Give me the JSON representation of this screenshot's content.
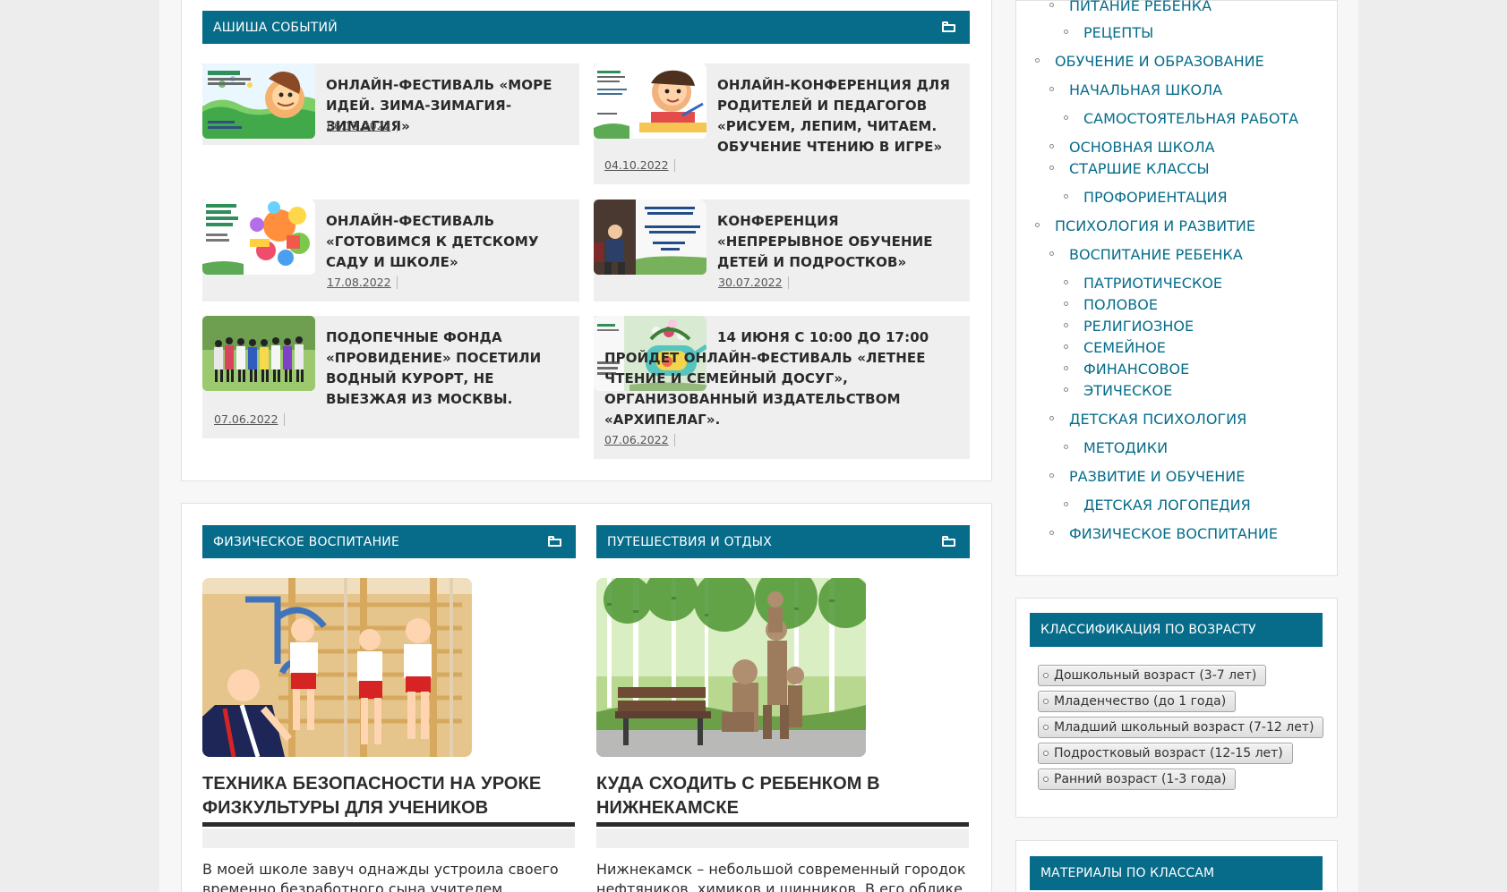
{
  "sections": {
    "events": {
      "title": "АШИША СОБЫТИЙ",
      "items": [
        {
          "title": "ОНЛАЙН-ФЕСТИВАЛЬ «МОРЕ ИДЕЙ. ЗИМА-ЗИМАГИЯ-ЗИМАГИЯ»",
          "date": "06.12.2022"
        },
        {
          "title": "ОНЛАЙН-КОНФЕРЕНЦИЯ ДЛЯ РОДИТЕЛЕЙ И ПЕДАГОГОВ «РИСУЕМ, ЛЕПИМ, ЧИТАЕМ. ОБУЧЕНИЕ ЧТЕНИЮ В ИГРЕ»",
          "date": "04.10.2022"
        },
        {
          "title": "ОНЛАЙН-ФЕСТИВАЛЬ «ГОТОВИМСЯ К ДЕТСКОМУ САДУ И ШКОЛЕ»",
          "date": "17.08.2022"
        },
        {
          "title": "КОНФЕРЕНЦИЯ «НЕПРЕРЫВНОЕ ОБУЧЕНИЕ ДЕТЕЙ И ПОДРОСТКОВ»",
          "date": "30.07.2022"
        },
        {
          "title": "ПОДОПЕЧНЫЕ ФОНДА «ПРОВИДЕНИЕ» ПОСЕТИЛИ ВОДНЫЙ КУРОРТ, НЕ ВЫЕЗЖАЯ ИЗ МОСКВЫ.",
          "date": "07.06.2022"
        },
        {
          "title": "14 ИЮНЯ С 10:00 ДО 17:00 ПРОЙДЕТ ОНЛАЙН-ФЕСТИВАЛЬ «ЛЕТНЕЕ ЧТЕНИЕ И СЕМЕЙНЫЙ ДОСУГ», ОРГАНИЗОВАННЫЙ ИЗДАТЕЛЬСТВОМ «АРХИПЕЛАГ».",
          "date": "07.06.2022"
        }
      ]
    },
    "physical": {
      "title": "ФИЗИЧЕСКОЕ ВОСПИТАНИЕ",
      "article_title": "ТЕХНИКА БЕЗОПАСНОСТИ НА УРОКЕ ФИЗКУЛЬТУРЫ ДЛЯ УЧЕНИКОВ",
      "excerpt": "В моей школе завуч однажды устроила своего временно безработного сына учителем"
    },
    "travel": {
      "title": "ПУТЕШЕСТВИЯ И ОТДЫХ",
      "article_title": "КУДА СХОДИТЬ С РЕБЕНКОМ В НИЖНЕКАМСКЕ",
      "excerpt": "Нижнекамск – небольшой современный городок нефтяников, химиков и шинников. В его облике"
    }
  },
  "sidebar": {
    "categories": [
      "ПИТАНИЕ РЕБЕНКА",
      "РЕЦЕПТЫ",
      "ОБУЧЕНИЕ И ОБРАЗОВАНИЕ",
      "НАЧАЛЬНАЯ ШКОЛА",
      "САМОСТОЯТЕЛЬНАЯ РАБОТА",
      "ОСНОВНАЯ ШКОЛА",
      "СТАРШИЕ КЛАССЫ",
      "ПРОФОРИЕНТАЦИЯ",
      "ПСИХОЛОГИЯ И РАЗВИТИЕ",
      "ВОСПИТАНИЕ РЕБЕНКА",
      "ПАТРИОТИЧЕСКОЕ",
      "ПОЛОВОЕ",
      "РЕЛИГИОЗНОЕ",
      "СЕМЕЙНОЕ",
      "ФИНАНСОВОЕ",
      "ЭТИЧЕСКОЕ",
      "ДЕТСКАЯ ПСИХОЛОГИЯ",
      "МЕТОДИКИ",
      "РАЗВИТИЕ И ОБУЧЕНИЕ",
      "ДЕТСКАЯ ЛОГОПЕДИЯ",
      "ФИЗИЧЕСКОЕ ВОСПИТАНИЕ"
    ],
    "age": {
      "title": "КЛАССИФИКАЦИЯ ПО ВОЗРАСТУ",
      "tags": [
        "Дошкольный возраст (3-7 лет)",
        "Младенчество (до 1 года)",
        "Младший школьный возраст (7-12 лет)",
        "Подростковый возраст (12-15 лет)",
        "Ранний возраст (1-3 года)"
      ]
    },
    "materials": {
      "title": "МАТЕРИАЛЫ ПО КЛАССАМ"
    }
  },
  "colors": {
    "accent": "#066c8a",
    "page_bg": "#ededed",
    "card_bg": "#ffffff",
    "event_bg": "#efefef"
  },
  "icons": {
    "section_action": "folder-open-icon",
    "bullet": "circle-outline-icon"
  }
}
